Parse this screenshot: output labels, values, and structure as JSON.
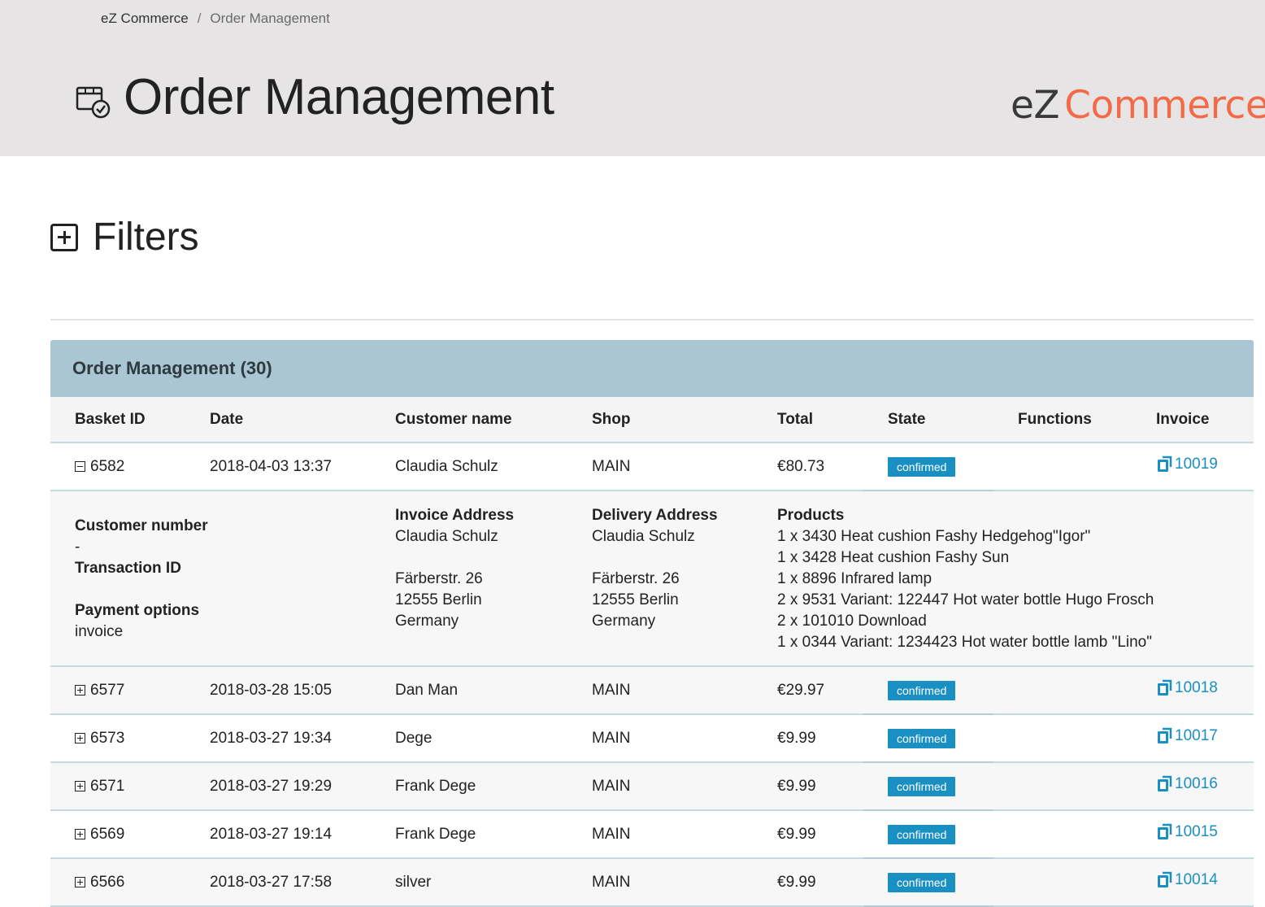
{
  "breadcrumb": {
    "home": "eZ Commerce",
    "separator": "/",
    "current": "Order Management"
  },
  "header": {
    "title": "Order Management",
    "icon": "order-box-check-icon"
  },
  "logo": {
    "ez": "eZ",
    "commerce": "Commerce",
    "color_ez": "#3a3a3a",
    "color_commerce": "#f26a47"
  },
  "filters": {
    "title": "Filters",
    "icon": "plus-square-icon"
  },
  "panel": {
    "title": "Order Management (30)"
  },
  "columns": [
    "Basket ID",
    "Date",
    "Customer name",
    "Shop",
    "Total",
    "State",
    "Functions",
    "Invoice"
  ],
  "orders": [
    {
      "basket_id": "6582",
      "date": "2018-04-03 13:37",
      "customer": "Claudia Schulz",
      "shop": "MAIN",
      "total": "€80.73",
      "state": "confirmed",
      "invoice": "10019",
      "expanded": true
    },
    {
      "basket_id": "6577",
      "date": "2018-03-28 15:05",
      "customer": "Dan Man",
      "shop": "MAIN",
      "total": "€29.97",
      "state": "confirmed",
      "invoice": "10018",
      "expanded": false
    },
    {
      "basket_id": "6573",
      "date": "2018-03-27 19:34",
      "customer": "Dege",
      "shop": "MAIN",
      "total": "€9.99",
      "state": "confirmed",
      "invoice": "10017",
      "expanded": false
    },
    {
      "basket_id": "6571",
      "date": "2018-03-27 19:29",
      "customer": "Frank Dege",
      "shop": "MAIN",
      "total": "€9.99",
      "state": "confirmed",
      "invoice": "10016",
      "expanded": false
    },
    {
      "basket_id": "6569",
      "date": "2018-03-27 19:14",
      "customer": "Frank Dege",
      "shop": "MAIN",
      "total": "€9.99",
      "state": "confirmed",
      "invoice": "10015",
      "expanded": false
    },
    {
      "basket_id": "6566",
      "date": "2018-03-27 17:58",
      "customer": "silver",
      "shop": "MAIN",
      "total": "€9.99",
      "state": "confirmed",
      "invoice": "10014",
      "expanded": false
    }
  ],
  "detail": {
    "customer_number_label": "Customer number",
    "customer_number": "-",
    "transaction_id_label": "Transaction ID",
    "transaction_id": "",
    "payment_options_label": "Payment options",
    "payment_options": "invoice",
    "invoice_address_label": "Invoice Address",
    "invoice_address": {
      "name": "Claudia Schulz",
      "blank": "",
      "street": "Färberstr. 26",
      "city": "12555 Berlin",
      "country": "Germany"
    },
    "delivery_address_label": "Delivery Address",
    "delivery_address": {
      "name": "Claudia Schulz",
      "blank": "",
      "street": "Färberstr. 26",
      "city": "12555 Berlin",
      "country": "Germany"
    },
    "products_label": "Products",
    "products": [
      "1 x 3430 Heat cushion Fashy Hedgehog\"Igor\"",
      "1 x 3428 Heat cushion Fashy Sun",
      "1 x 8896 Infrared lamp",
      "2 x 9531 Variant: 122447 Hot water bottle Hugo Frosch",
      "2 x 101010 Download",
      "1 x 0344 Variant: 1234423 Hot water bottle lamb \"Lino\""
    ]
  },
  "colors": {
    "topbar": "#e6e4e5",
    "panel_heading": "#a9c6d2",
    "accent": "#1a8fc1"
  }
}
